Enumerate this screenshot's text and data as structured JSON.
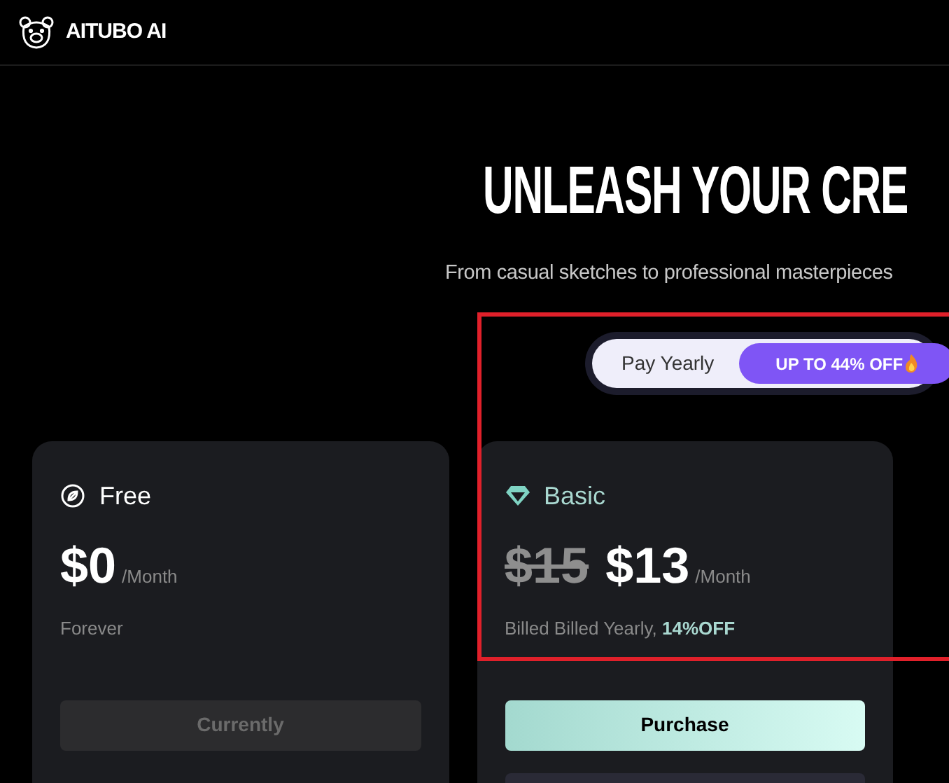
{
  "header": {
    "brand": "AITUBO AI"
  },
  "hero": {
    "title": "UNLEASH YOUR CRE",
    "subtitle": "From casual sketches to professional masterpieces"
  },
  "billing_toggle": [
    {
      "label": "Pay Yearly",
      "selected": false
    },
    {
      "label": "UP TO 44% OFF",
      "selected": true
    }
  ],
  "plans": [
    {
      "kind": "free",
      "name": "Free",
      "price": "$0",
      "period": "/Month",
      "note": "Forever",
      "button": "Currently",
      "disabled": true
    },
    {
      "kind": "basic",
      "name": "Basic",
      "old_price": "$15",
      "price": "$13",
      "period": "/Month",
      "note": "Billed Billed Yearly, ",
      "note_highlight": "14%OFF",
      "button": "Purchase",
      "disabled": false
    }
  ]
}
